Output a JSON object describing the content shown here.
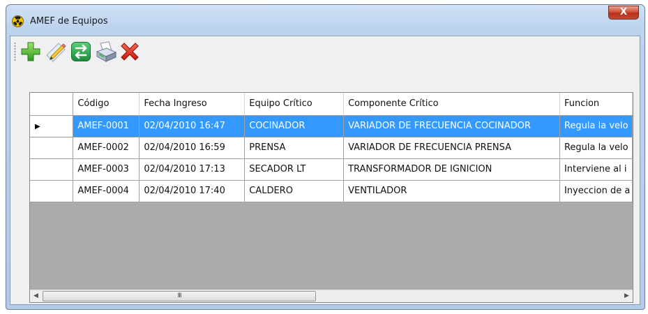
{
  "window": {
    "title": "AMEF de Equipos",
    "close_glyph": "X"
  },
  "toolbar": {
    "buttons": [
      {
        "name": "add",
        "icon": "plus-icon"
      },
      {
        "name": "edit",
        "icon": "pencil-icon"
      },
      {
        "name": "exchange",
        "icon": "arrows-icon"
      },
      {
        "name": "print",
        "icon": "printer-icon"
      },
      {
        "name": "delete",
        "icon": "red-x-icon"
      }
    ]
  },
  "grid": {
    "columns": [
      "Código",
      "Fecha Ingreso",
      "Equipo Crítico",
      "Componente Crítico",
      "Funcion"
    ],
    "rows": [
      [
        "AMEF-0001",
        "02/04/2010 16:47",
        "COCINADOR",
        "VARIADOR DE FRECUENCIA COCINADOR",
        "Regula la velo"
      ],
      [
        "AMEF-0002",
        "02/04/2010 16:59",
        "PRENSA",
        "VARIADOR DE FRECUENCIA PRENSA",
        "Regula la velo"
      ],
      [
        "AMEF-0003",
        "02/04/2010 17:13",
        "SECADOR LT",
        "TRANSFORMADOR DE IGNICION",
        "Interviene al i"
      ],
      [
        "AMEF-0004",
        "02/04/2010 17:40",
        "CALDERO",
        "VENTILADOR",
        "Inyeccion de a"
      ]
    ],
    "selected_row": 0,
    "row_indicator": "▶"
  },
  "scrollbar": {
    "left_arrow": "◀",
    "right_arrow": "▶",
    "thumb_grip": "III"
  },
  "colors": {
    "selection": "#3399ff",
    "empty_area": "#ababab"
  }
}
